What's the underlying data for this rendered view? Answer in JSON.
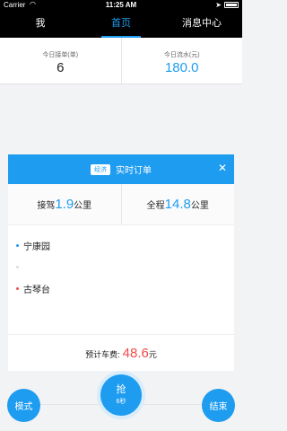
{
  "status_bar": {
    "carrier": "Carrier",
    "time": "11:25 AM"
  },
  "nav": {
    "tabs": [
      {
        "label": "我"
      },
      {
        "label": "首页",
        "active": true
      },
      {
        "label": "消息中心"
      }
    ]
  },
  "stats": {
    "orders_label": "今日接单(单)",
    "orders_value": "6",
    "income_label": "今日流水(元)",
    "income_value": "180.0"
  },
  "order": {
    "badge": "经济",
    "title": "实时订单",
    "pickup_prefix": "接驾",
    "pickup_distance": "1.9",
    "pickup_unit": "公里",
    "trip_prefix": "全程",
    "trip_distance": "14.8",
    "trip_unit": "公里",
    "origin": "宁康园",
    "destination": "古琴台",
    "fare_label": "预计车费:",
    "fare_value": "48.6",
    "fare_unit": "元"
  },
  "controls": {
    "mode_label": "模式",
    "grab_label": "抢",
    "grab_timer": "6秒",
    "end_label": "结束"
  },
  "colors": {
    "accent": "#1e9cf0",
    "price": "#f24b4b"
  }
}
